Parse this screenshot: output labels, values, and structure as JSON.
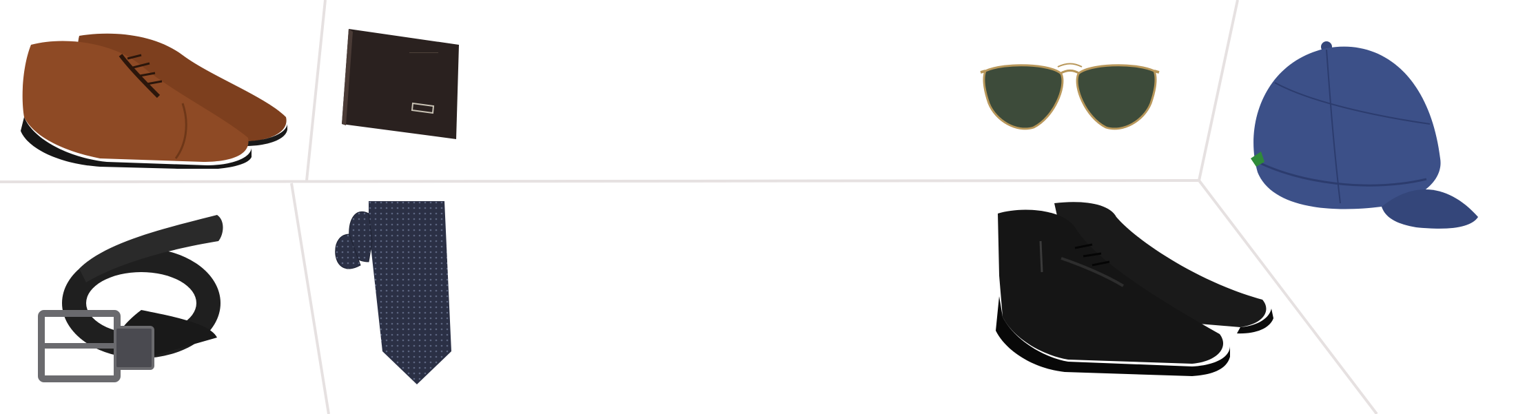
{
  "banner": {
    "name": "mens-accessories-collage",
    "divider_color": "#e6e1e1"
  },
  "products": [
    {
      "id": "oxford-shoes",
      "icon": "brown-oxford-shoes-icon",
      "color": "#8a4a24"
    },
    {
      "id": "wallet",
      "icon": "bifold-wallet-icon",
      "color": "#2a1f1c"
    },
    {
      "id": "aviator-sunglasses",
      "icon": "aviator-sunglasses-icon",
      "color": "#3e4a3a"
    },
    {
      "id": "baseball-cap",
      "icon": "navy-cap-icon",
      "color": "#3a4e86"
    },
    {
      "id": "reversible-belt",
      "icon": "leather-belt-icon",
      "color": "#1e1e1e"
    },
    {
      "id": "neck-tie",
      "icon": "patterned-tie-icon",
      "color": "#2b3045"
    },
    {
      "id": "chukka-boots",
      "icon": "black-chukka-boots-icon",
      "color": "#151515"
    }
  ]
}
